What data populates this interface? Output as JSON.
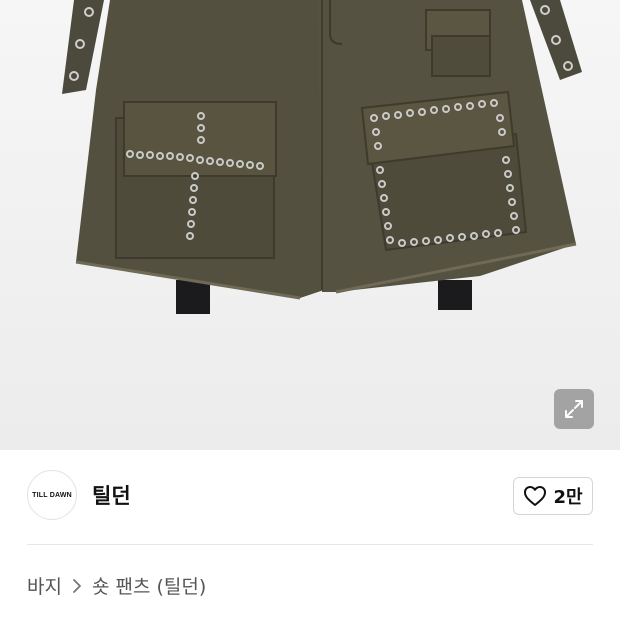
{
  "brand": {
    "logo_text": "TILL DAWN",
    "name": "틸던"
  },
  "likes": {
    "count": "2만",
    "icon": "heart-outline-icon"
  },
  "breadcrumb": {
    "items": [
      {
        "label": "바지"
      },
      {
        "label": "숏 팬츠 (틸던)"
      }
    ],
    "separator_icon": "chevron-right-icon"
  },
  "image_actions": {
    "expand_icon": "expand-arrows-icon"
  }
}
